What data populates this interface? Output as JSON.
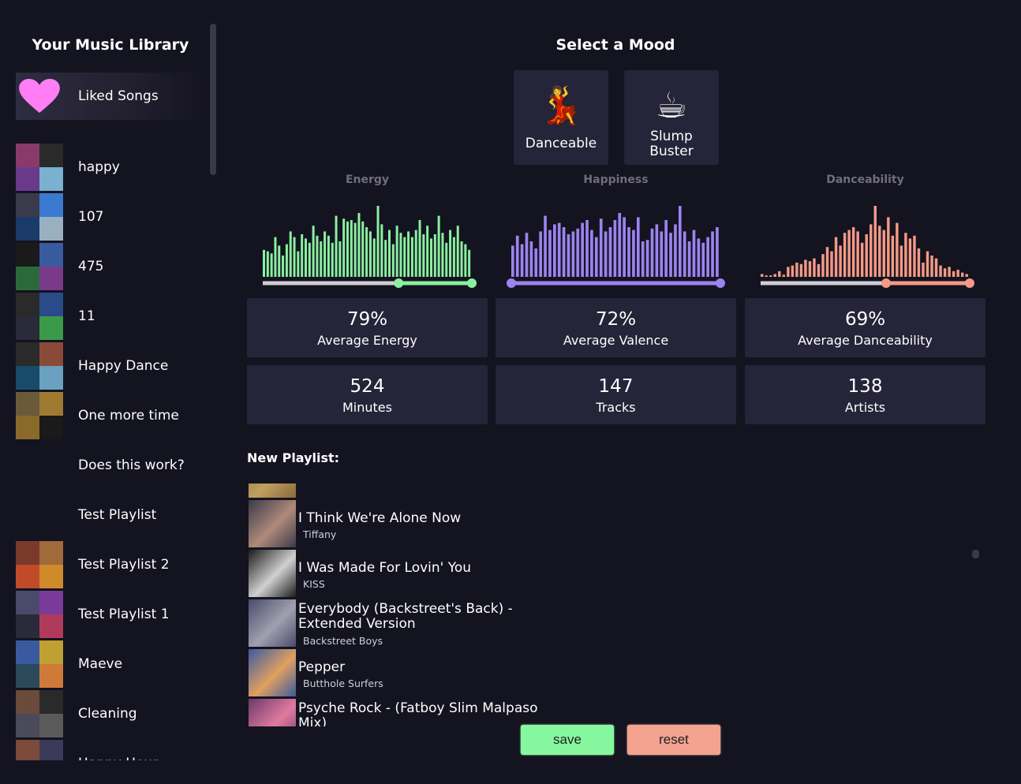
{
  "library": {
    "title": "Your Music Library",
    "liked": {
      "name": "Liked Songs",
      "icon": "heart-icon",
      "color": "#ff7ef5"
    },
    "playlists": [
      {
        "name": "happy",
        "colors": [
          "#8a3a6a",
          "#2a2a2a",
          "#6a3a8a",
          "#7ab0d0"
        ]
      },
      {
        "name": "107",
        "colors": [
          "#3a3a4a",
          "#3a7ad0",
          "#1a3a6a",
          "#9ab0c0"
        ]
      },
      {
        "name": "475",
        "colors": [
          "#1a1a1a",
          "#3a5aa0",
          "#2a6a3a",
          "#7a3a8a"
        ]
      },
      {
        "name": "11",
        "colors": [
          "#2a2a2a",
          "#2a4a8a",
          "#2a2a3a",
          "#3a9a4a"
        ]
      },
      {
        "name": "Happy Dance",
        "colors": [
          "#2a2a2a",
          "#8a4a3a",
          "#1a4a6a",
          "#6aa0c0"
        ]
      },
      {
        "name": "One more time",
        "colors": [
          "#6a5a3a",
          "#a07a30",
          "#8a6a2a",
          "#1a1a1a"
        ]
      },
      {
        "name": "Does this work?",
        "colors": null
      },
      {
        "name": "Test Playlist",
        "colors": null
      },
      {
        "name": "Test Playlist 2",
        "colors": [
          "#7a3a2a",
          "#a06a3a",
          "#c04a2a",
          "#d08a2a"
        ]
      },
      {
        "name": "Test Playlist 1",
        "colors": [
          "#4a4a6a",
          "#7a3a9a",
          "#2a2a3a",
          "#b03a5a"
        ]
      },
      {
        "name": "Maeve",
        "colors": [
          "#3a5aa0",
          "#c0a030",
          "#2a4a5a",
          "#d07a3a"
        ]
      },
      {
        "name": "Cleaning",
        "colors": [
          "#6a4a3a",
          "#2a2a2a",
          "#4a4a5a",
          "#5a5a5a"
        ]
      },
      {
        "name": "Happy Hour",
        "colors": [
          "#7a4a3a",
          "#3a3a5a",
          "#2a2a3a",
          "#5a3a3a"
        ]
      }
    ]
  },
  "mood": {
    "title": "Select a Mood",
    "buttons": [
      {
        "label": "Danceable",
        "emoji": "💃",
        "icon": "dancer-icon"
      },
      {
        "label": "Slump Buster",
        "emoji": "☕",
        "icon": "coffee-icon"
      }
    ]
  },
  "charts": [
    {
      "title": "Energy",
      "color": "#8af0a0",
      "range": [
        0.65,
        1.0
      ],
      "values": [
        0.38,
        0.36,
        0.33,
        0.56,
        0.44,
        0.3,
        0.46,
        0.64,
        0.56,
        0.36,
        0.6,
        0.54,
        0.48,
        0.72,
        0.58,
        0.5,
        0.64,
        0.58,
        0.48,
        0.86,
        0.5,
        0.82,
        0.78,
        0.8,
        0.76,
        0.9,
        0.78,
        0.7,
        0.64,
        0.54,
        1.0,
        0.74,
        0.52,
        0.66,
        0.46,
        0.72,
        0.62,
        0.56,
        0.64,
        0.56,
        0.66,
        0.8,
        0.6,
        0.72,
        0.54,
        0.6,
        0.86,
        0.62,
        0.48,
        0.66,
        0.56,
        0.72,
        0.5,
        0.46,
        0.38
      ]
    },
    {
      "title": "Happiness",
      "color": "#9b84f0",
      "range": [
        0.0,
        1.0
      ],
      "values": [
        0.44,
        0.58,
        0.46,
        0.62,
        0.5,
        0.4,
        0.64,
        0.86,
        0.66,
        0.74,
        0.76,
        0.7,
        0.6,
        0.64,
        0.68,
        0.76,
        0.8,
        0.66,
        0.56,
        0.82,
        0.64,
        0.7,
        0.8,
        0.9,
        0.84,
        0.7,
        0.66,
        0.84,
        0.5,
        0.52,
        0.68,
        0.74,
        0.64,
        0.8,
        0.62,
        0.74,
        1.0,
        0.64,
        0.5,
        0.66,
        0.54,
        0.48,
        0.56,
        0.64,
        0.7
      ]
    },
    {
      "title": "Danceability",
      "color": "#f49a86",
      "range": [
        0.6,
        1.0
      ],
      "values": [
        0.04,
        0.02,
        0.02,
        0.04,
        0.08,
        0.03,
        0.14,
        0.16,
        0.2,
        0.18,
        0.24,
        0.22,
        0.26,
        0.18,
        0.32,
        0.42,
        0.36,
        0.56,
        0.44,
        0.62,
        0.66,
        0.7,
        0.64,
        0.48,
        0.6,
        0.74,
        1.0,
        0.72,
        0.66,
        0.84,
        0.58,
        0.76,
        0.44,
        0.62,
        0.54,
        0.58,
        0.4,
        0.2,
        0.36,
        0.3,
        0.26,
        0.16,
        0.12,
        0.14,
        0.08,
        0.1,
        0.06,
        0.04
      ]
    }
  ],
  "stats": [
    {
      "value": "79%",
      "label": "Average Energy"
    },
    {
      "value": "72%",
      "label": "Average Valence"
    },
    {
      "value": "69%",
      "label": "Average Danceability"
    },
    {
      "value": "524",
      "label": "Minutes"
    },
    {
      "value": "147",
      "label": "Tracks"
    },
    {
      "value": "138",
      "label": "Artists"
    }
  ],
  "new_playlist": {
    "title": "New Playlist:",
    "tracks": [
      {
        "name": "",
        "artist": "",
        "colors": [
          "#8a6a3a",
          "#c0a060"
        ]
      },
      {
        "name": "I Think We're Alone Now",
        "artist": "Tiffany",
        "colors": [
          "#3a3a4a",
          "#b08a7a"
        ]
      },
      {
        "name": "I Was Made For Lovin' You",
        "artist": "KISS",
        "colors": [
          "#1a1a1a",
          "#d0d0d0"
        ]
      },
      {
        "name": "Everybody (Backstreet's Back) - Extended Version",
        "artist": "Backstreet Boys",
        "colors": [
          "#4a4a6a",
          "#a0a0b0"
        ]
      },
      {
        "name": "Pepper",
        "artist": "Butthole Surfers",
        "colors": [
          "#3a5aa0",
          "#e0a060"
        ]
      },
      {
        "name": "Psyche Rock - (Fatboy Slim Malpaso Mix)",
        "artist": "",
        "colors": [
          "#6a3a6a",
          "#e07aa0"
        ]
      }
    ]
  },
  "actions": {
    "save": "save",
    "reset": "reset"
  }
}
